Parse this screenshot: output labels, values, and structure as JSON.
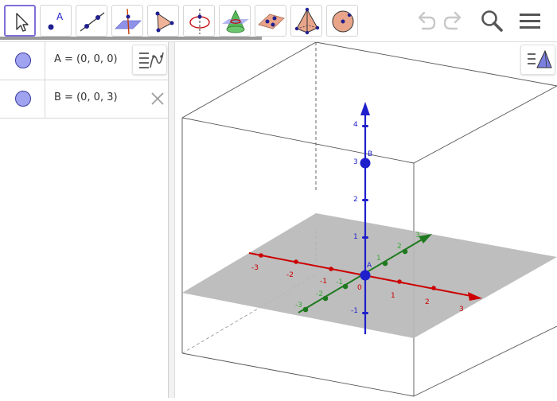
{
  "toolbar": {
    "tools": [
      {
        "name": "move-tool",
        "icon": "cursor-arrow-icon",
        "selected": true
      },
      {
        "name": "point-tool",
        "icon": "point-icon",
        "label": "A"
      },
      {
        "name": "line-tool",
        "icon": "line-through-points-icon"
      },
      {
        "name": "perpendicular-line-tool",
        "icon": "perpendicular-line-icon"
      },
      {
        "name": "polygon-tool",
        "icon": "polygon-icon"
      },
      {
        "name": "circle-axis-tool",
        "icon": "circle-around-axis-icon"
      },
      {
        "name": "intersect-surfaces-tool",
        "icon": "intersect-cone-plane-icon"
      },
      {
        "name": "plane-through-points-tool",
        "icon": "plane-three-points-icon"
      },
      {
        "name": "pyramid-tool",
        "icon": "pyramid-icon"
      },
      {
        "name": "sphere-tool",
        "icon": "sphere-center-point-icon"
      }
    ],
    "right_icons": [
      "undo-icon",
      "redo-icon",
      "search-icon",
      "menu-icon"
    ]
  },
  "algebra": {
    "items": [
      {
        "definition": "A = (0, 0, 0)",
        "color": "#a0a3f0"
      },
      {
        "definition": "B = (0, 0, 3)",
        "color": "#a0a3f0"
      }
    ]
  },
  "graphics3d": {
    "point_labels": {
      "A": "A",
      "B": "B"
    },
    "x_axis": {
      "color": "#cc0000",
      "ticks": [
        "-3",
        "-2",
        "-1",
        "0",
        "1",
        "2",
        "3"
      ]
    },
    "y_axis": {
      "color": "#1f7a1f",
      "ticks": [
        "-3",
        "-2",
        "-1",
        "1",
        "2",
        "3"
      ]
    },
    "z_axis": {
      "color": "#1f1fcc",
      "ticks": [
        "-1",
        "1",
        "2",
        "3",
        "4"
      ]
    }
  }
}
